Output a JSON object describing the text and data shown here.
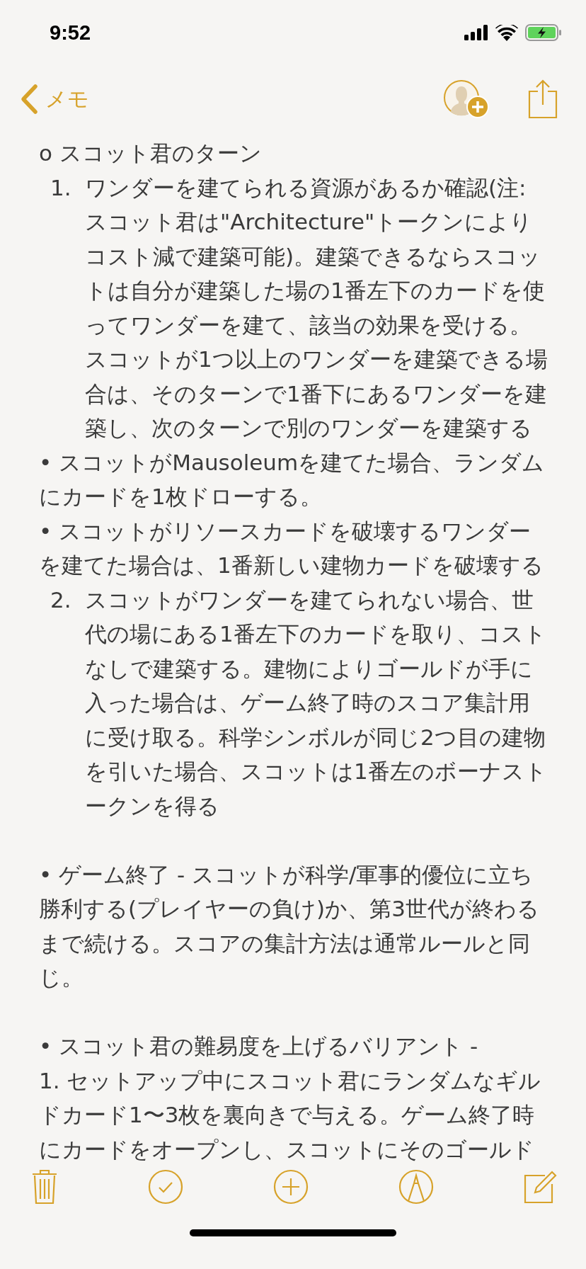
{
  "status_bar": {
    "time": "9:52"
  },
  "nav": {
    "back_label": "メモ"
  },
  "note": {
    "blocks": [
      {
        "kind": "line",
        "text": "o スコット君のターン"
      },
      {
        "kind": "numbered",
        "marker": "1.",
        "text": "ワンダーを建てられる資源があるか確認(注: スコット君は\"Architecture\"トークンによりコスト減で建築可能)。建築できるならスコットは自分が建築した場の1番左下のカードを使ってワンダーを建て、該当の効果を受ける。スコットが1つ以上のワンダーを建築できる場合は、そのターンで1番下にあるワンダーを建築し、次のターンで別のワンダーを建築する"
      },
      {
        "kind": "line",
        "text": "• スコットがMausoleumを建てた場合、ランダムにカードを1枚ドローする。"
      },
      {
        "kind": "line",
        "text": "• スコットがリソースカードを破壊するワンダーを建てた場合は、1番新しい建物カードを破壊する"
      },
      {
        "kind": "numbered",
        "marker": "2.",
        "text": "スコットがワンダーを建てられない場合、世代の場にある1番左下のカードを取り、コストなしで建築する。建物によりゴールドが手に入った場合は、ゲーム終了時のスコア集計用に受け取る。科学シンボルが同じ2つ目の建物を引いた場合、スコットは1番左のボーナストークンを得る"
      },
      {
        "kind": "line",
        "space_before": true,
        "text": "• ゲーム終了 - スコットが科学/軍事的優位に立ち勝利する(プレイヤーの負け)か、第3世代が終わるまで続ける。スコアの集計方法は通常ルールと同じ。"
      },
      {
        "kind": "line",
        "space_before": true,
        "text": "• スコット君の難易度を上げるバリアント -"
      },
      {
        "kind": "line",
        "text": "1. セットアップ中にスコット君にランダムなギルドカード1〜3枚を裏向きで与える。ゲーム終了時にカードをオープンし、スコットにそのゴールド"
      }
    ]
  }
}
